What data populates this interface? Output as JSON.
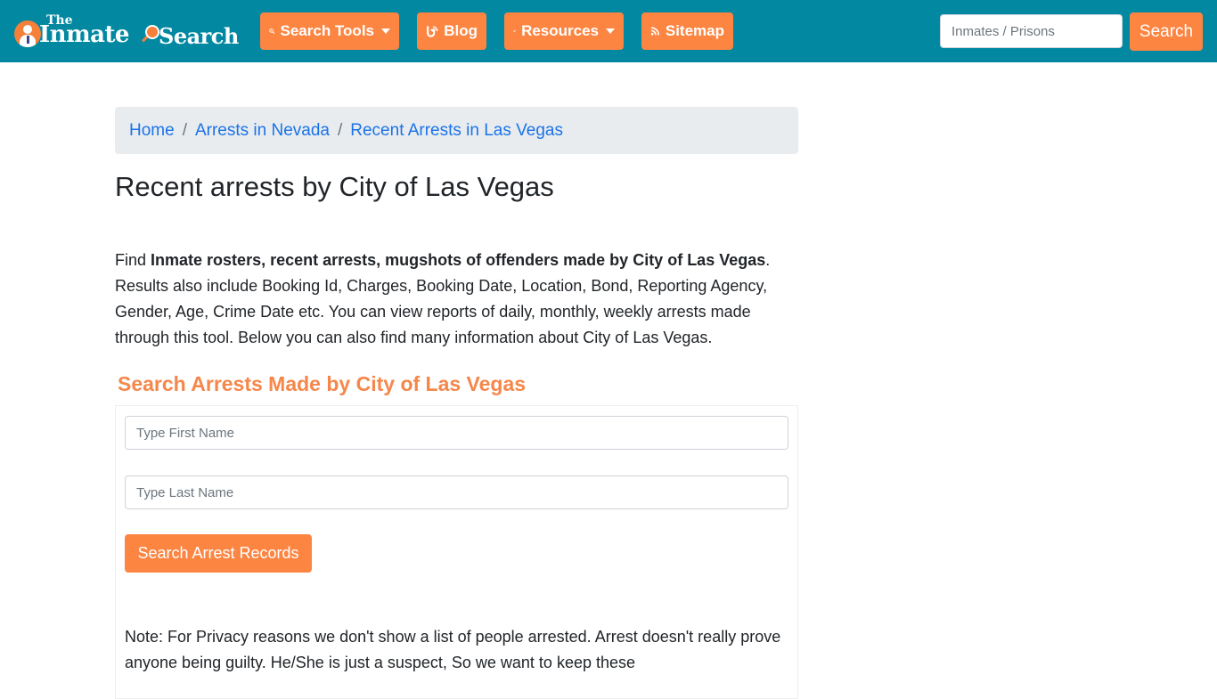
{
  "header": {
    "logo": {
      "the": "The",
      "inmate": "Inmate",
      "search": "Search"
    },
    "nav": [
      {
        "label": "Search Tools",
        "icon": "search-tools-icon",
        "dropdown": true
      },
      {
        "label": "Blog",
        "icon": "blog-icon",
        "dropdown": false
      },
      {
        "label": "Resources",
        "icon": "leaf-icon",
        "dropdown": true
      },
      {
        "label": "Sitemap",
        "icon": "rss-icon",
        "dropdown": false
      }
    ],
    "search": {
      "placeholder": "Inmates / Prisons",
      "button_label": "Search"
    }
  },
  "breadcrumb": [
    {
      "label": "Home"
    },
    {
      "label": "Arrests in Nevada"
    },
    {
      "label": "Recent Arrests in Las Vegas"
    }
  ],
  "page": {
    "title": "Recent arrests by City of Las Vegas",
    "intro": {
      "prefix": "Find ",
      "bold": "Inmate rosters, recent arrests, mugshots of offenders made by City of Las Vegas",
      "suffix": ". Results also include Booking Id, Charges, Booking Date, Location, Bond, Reporting Agency, Gender, Age, Crime Date etc. You can view reports of daily, monthly, weekly arrests made through this tool. Below you can also find many information about City of Las Vegas."
    },
    "search_section": {
      "title": "Search Arrests Made by City of Las Vegas",
      "first_name_placeholder": "Type First Name",
      "last_name_placeholder": "Type Last Name",
      "submit_label": "Search Arrest Records",
      "note": "Note: For Privacy reasons we don't show a list of people arrested. Arrest doesn't really prove anyone being guilty. He/She is just a suspect, So we want to keep these"
    }
  },
  "colors": {
    "navbar": "#0289a1",
    "accent": "#fc8542",
    "section_title": "#f5874b",
    "link": "#1a73e8",
    "breadcrumb_bg": "#e9ecef"
  }
}
